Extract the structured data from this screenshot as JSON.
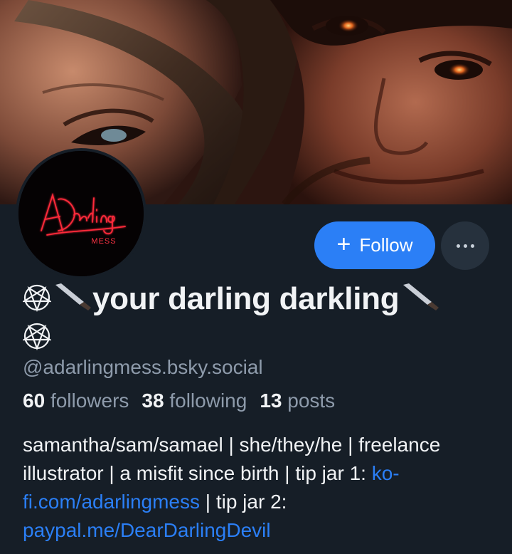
{
  "banner": {
    "description_icon": "banner-artwork"
  },
  "avatar": {
    "logo_text": "A Darling MESS",
    "accent": "#e0222e"
  },
  "actions": {
    "follow_label": "Follow",
    "follow_icon": "plus-icon",
    "more_icon": "ellipsis-icon"
  },
  "profile": {
    "display_name": "your darling darkling",
    "display_name_prefix_icons": [
      "pentagram-icon",
      "knife-icon"
    ],
    "display_name_suffix_icons": [
      "knife-icon",
      "pentagram-icon"
    ],
    "handle": "@adarlingmess.bsky.social"
  },
  "stats": {
    "followers_count": "60",
    "followers_label": "followers",
    "following_count": "38",
    "following_label": "following",
    "posts_count": "13",
    "posts_label": "posts"
  },
  "bio": {
    "text_1": "samantha/sam/samael | she/they/he | freelance illustrator | a misfit since birth | tip jar 1: ",
    "link_1": "ko-fi.com/adarlingmess",
    "text_2": " | tip jar 2: ",
    "link_2": "paypal.me/DearDarlingDevil"
  },
  "colors": {
    "background": "#161e27",
    "accent_blue": "#2b7ff6",
    "muted_text": "#8e9bab",
    "primary_text": "#f1f3f5"
  }
}
